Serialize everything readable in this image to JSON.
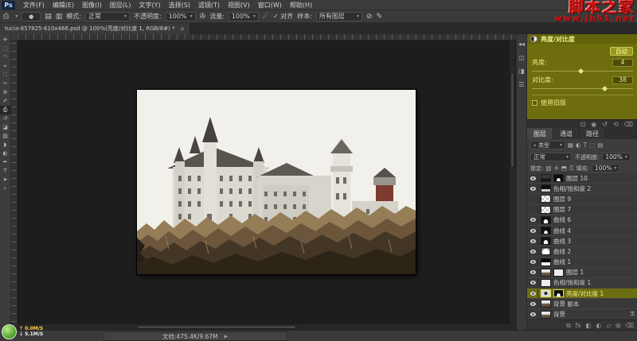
{
  "app": {
    "logo": "Ps"
  },
  "watermark": {
    "line1": "脚本之家",
    "line2": "www.jb51.net"
  },
  "menu": {
    "items": [
      "文件(F)",
      "编辑(E)",
      "图像(I)",
      "图层(L)",
      "文字(Y)",
      "选择(S)",
      "滤镜(T)",
      "视图(V)",
      "窗口(W)",
      "帮助(H)"
    ]
  },
  "options": {
    "mode_label": "模式:",
    "mode_value": "正常",
    "opacity_label": "不透明度:",
    "opacity_value": "100%",
    "flow_label": "流量:",
    "flow_value": "100%",
    "align_label": "对齐",
    "sample_label": "样本:",
    "sample_value": "所有图层"
  },
  "document_tab": {
    "title": "tucia-857825-610x466.psd @ 100%(亮度/对比度 1, RGB/8#) *",
    "close": "×"
  },
  "tools": [
    {
      "name": "move-tool",
      "glyph": "✛"
    },
    {
      "name": "marquee-tool",
      "glyph": "⬚"
    },
    {
      "name": "lasso-tool",
      "glyph": "◠"
    },
    {
      "name": "quick-selection-tool",
      "glyph": "⌖"
    },
    {
      "name": "crop-tool",
      "glyph": "⛶"
    },
    {
      "name": "eyedropper-tool",
      "glyph": "✑"
    },
    {
      "name": "healing-brush-tool",
      "glyph": "⊕"
    },
    {
      "name": "brush-tool",
      "glyph": "✐"
    },
    {
      "name": "clone-stamp-tool",
      "glyph": "⎙",
      "selected": true
    },
    {
      "name": "history-brush-tool",
      "glyph": "↺"
    },
    {
      "name": "eraser-tool",
      "glyph": "◪"
    },
    {
      "name": "gradient-tool",
      "glyph": "▨"
    },
    {
      "name": "blur-tool",
      "glyph": "◗"
    },
    {
      "name": "dodge-tool",
      "glyph": "◐"
    },
    {
      "name": "pen-tool",
      "glyph": "✒"
    },
    {
      "name": "type-tool",
      "glyph": "T"
    },
    {
      "name": "path-selection-tool",
      "glyph": "➤"
    },
    {
      "name": "zoom-tool",
      "glyph": "⌕"
    }
  ],
  "properties_panel": {
    "title": "亮度/对比度",
    "auto_button": "自动",
    "brightness_label": "亮度:",
    "brightness_value": "4",
    "contrast_label": "对比度:",
    "contrast_value": "38",
    "legacy_label": "使用旧版"
  },
  "layers_panel": {
    "tabs": [
      {
        "label": "图层",
        "active": true
      },
      {
        "label": "通道"
      },
      {
        "label": "路径"
      }
    ],
    "filter_label": "类型",
    "blend_mode": "正常",
    "opacity_label": "不透明度:",
    "opacity_value": "100%",
    "lock_label": "锁定:",
    "fill_label": "填充:",
    "fill_value": "100%",
    "layers": [
      {
        "name": "图层 10",
        "thumb": "photo-dark",
        "mask": "mask-dark",
        "eye": true
      },
      {
        "name": "色相/饱和度 2",
        "thumb": "mask-gray",
        "eye": true
      },
      {
        "name": "图层 9",
        "thumb": "checker",
        "eye": false
      },
      {
        "name": "图层 7",
        "thumb": "checker",
        "eye": false
      },
      {
        "name": "曲线 6",
        "thumb": "mask-blob",
        "eye": true
      },
      {
        "name": "曲线 4",
        "thumb": "mask-dark",
        "eye": true
      },
      {
        "name": "曲线 3",
        "thumb": "mask-blob",
        "eye": true
      },
      {
        "name": "曲线 2",
        "thumb": "mask-light",
        "eye": true
      },
      {
        "name": "曲线 1",
        "thumb": "mask-split",
        "eye": true
      },
      {
        "name": "图层 1",
        "thumb": "photo",
        "mask": "mask-white",
        "eye": true
      },
      {
        "name": "色相/饱和度 1",
        "thumb": "mask-white",
        "eye": true
      },
      {
        "name": "亮度/对比度 1",
        "thumb": "adj-bc",
        "mask": "mask-dark",
        "eye": true,
        "selected": true
      },
      {
        "name": "背景 副本",
        "thumb": "photo",
        "eye": true
      },
      {
        "name": "背景",
        "thumb": "photo",
        "eye": true,
        "locked": true
      }
    ]
  },
  "statusbar": {
    "doc_info": "文档:475.4K/9.67M",
    "speed_up": "↑ 0.0M/S",
    "speed_down": "↓ 5.1M/S"
  }
}
